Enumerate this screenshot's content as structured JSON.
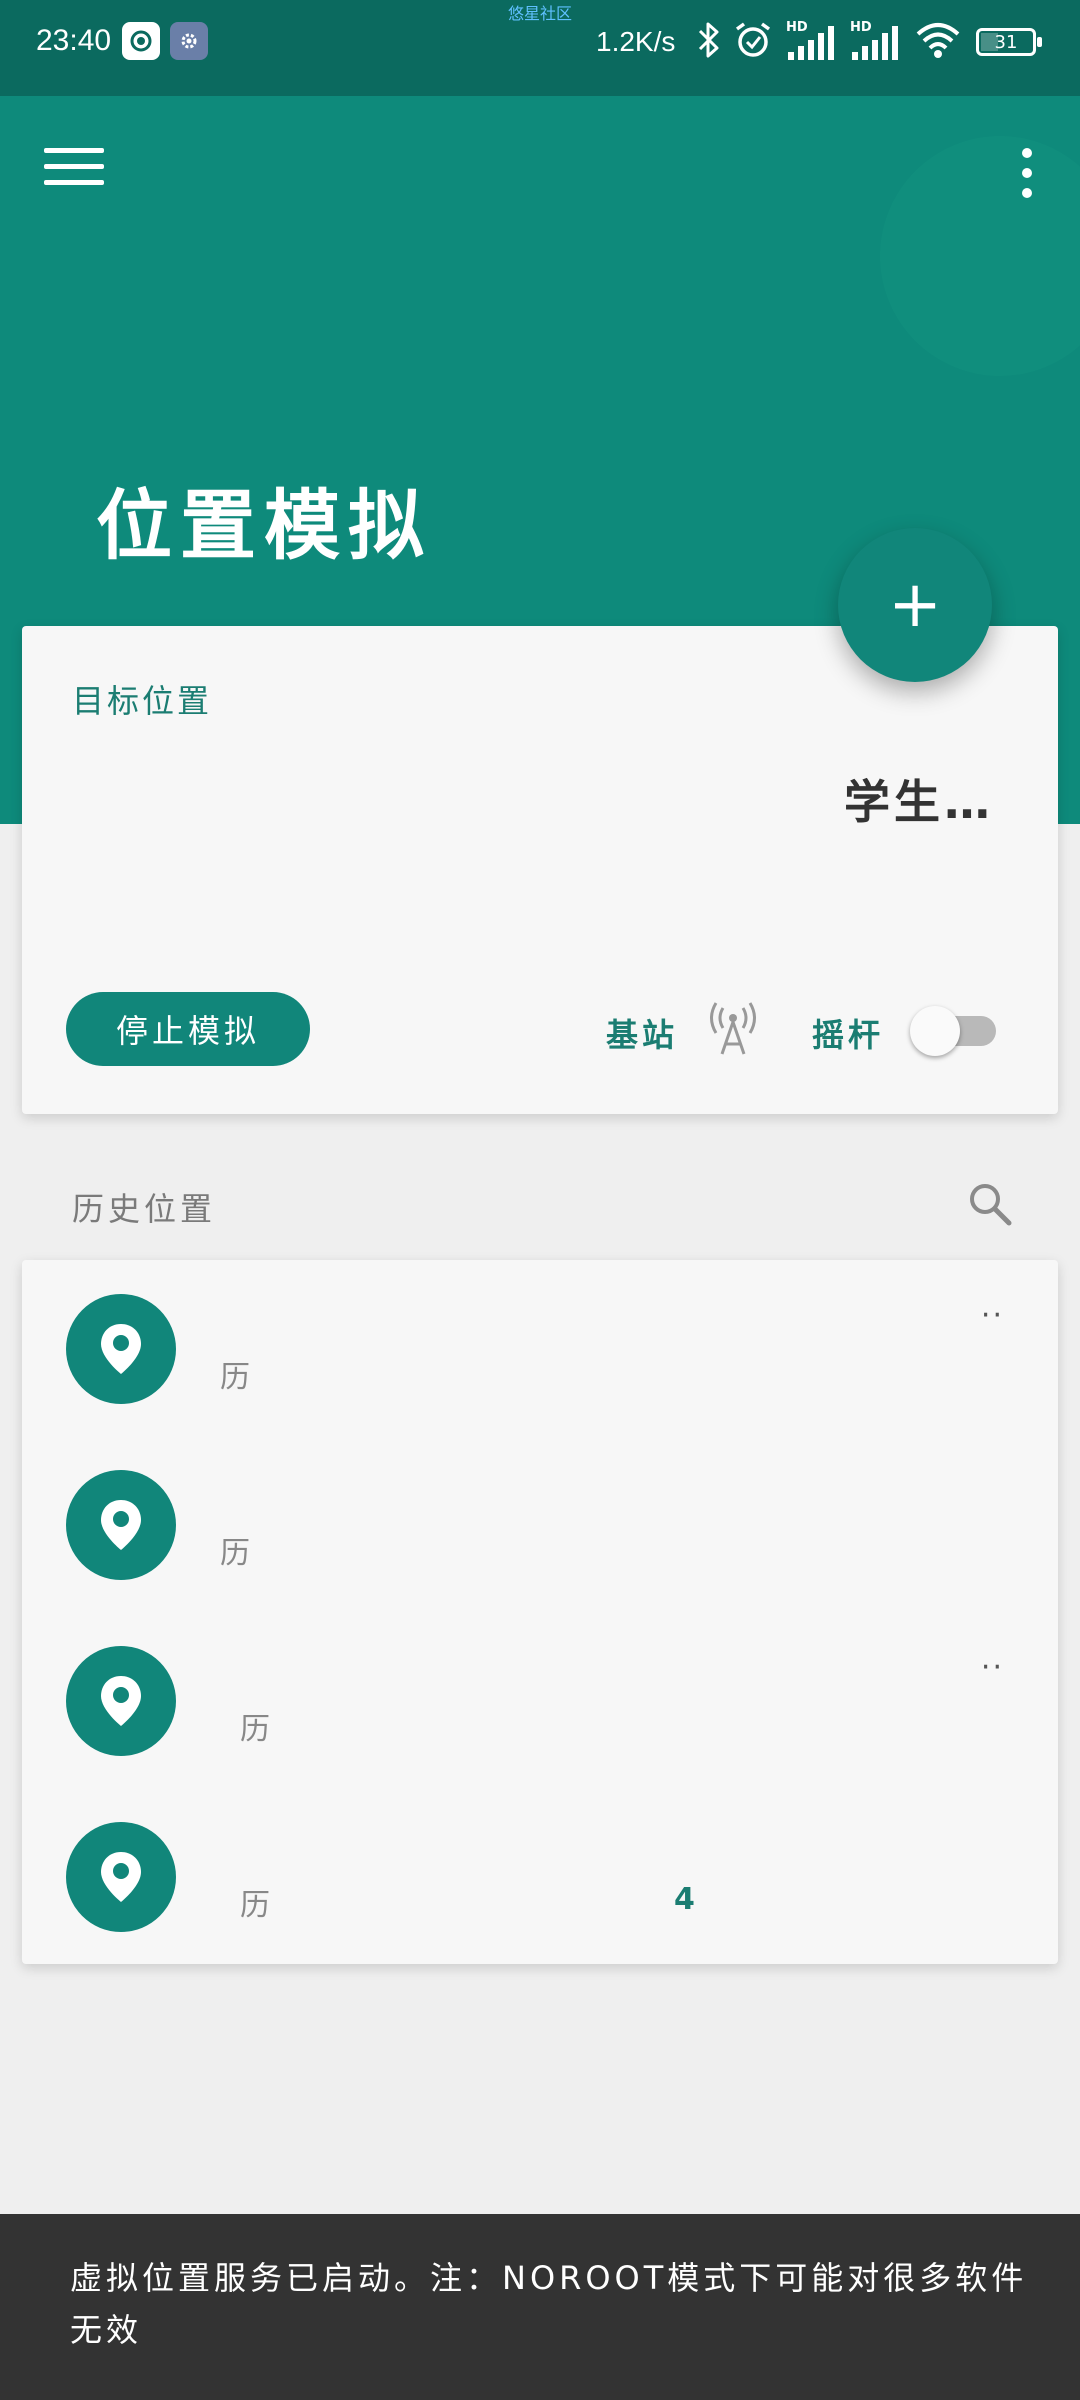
{
  "status_bar": {
    "time": "23:40",
    "watermark": "悠星社区",
    "network_speed": "1.2K/s",
    "signal_1_label": "HD",
    "signal_2_label": "HD",
    "battery": "31",
    "battery_level": 0.31
  },
  "header": {
    "title": "位置模拟",
    "color": "#0e8a7b"
  },
  "fab": {
    "label": "+"
  },
  "target_card": {
    "label": "目标位置",
    "location_name": "学生…",
    "stop_button": "停止模拟",
    "base_station_label": "基站",
    "joystick_label": "摇杆",
    "joystick_on": false
  },
  "history": {
    "title": "历史位置",
    "items": [
      {
        "text": "历",
        "more": "··",
        "count": ""
      },
      {
        "text": "历",
        "more": "",
        "count": ""
      },
      {
        "text": "历",
        "more": "··",
        "count": ""
      },
      {
        "text": "历",
        "more": "",
        "count": "4"
      }
    ]
  },
  "snackbar": {
    "message": "虚拟位置服务已启动。注：NOROOT模式下可能对很多软件无效"
  },
  "colors": {
    "accent": "#11867a",
    "accent_text": "#1b7d72",
    "background": "#efefef",
    "snackbar": "#333333"
  }
}
